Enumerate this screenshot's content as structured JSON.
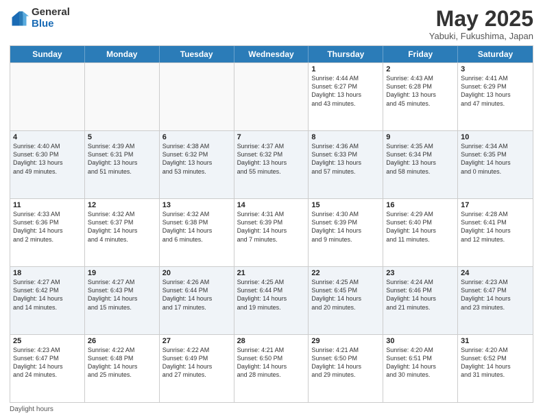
{
  "logo": {
    "general": "General",
    "blue": "Blue"
  },
  "title": "May 2025",
  "location": "Yabuki, Fukushima, Japan",
  "days_of_week": [
    "Sunday",
    "Monday",
    "Tuesday",
    "Wednesday",
    "Thursday",
    "Friday",
    "Saturday"
  ],
  "footer": {
    "daylight_hours": "Daylight hours"
  },
  "rows": [
    [
      {
        "day": "",
        "info": "",
        "empty": true
      },
      {
        "day": "",
        "info": "",
        "empty": true
      },
      {
        "day": "",
        "info": "",
        "empty": true
      },
      {
        "day": "",
        "info": "",
        "empty": true
      },
      {
        "day": "1",
        "info": "Sunrise: 4:44 AM\nSunset: 6:27 PM\nDaylight: 13 hours\nand 43 minutes.",
        "empty": false
      },
      {
        "day": "2",
        "info": "Sunrise: 4:43 AM\nSunset: 6:28 PM\nDaylight: 13 hours\nand 45 minutes.",
        "empty": false
      },
      {
        "day": "3",
        "info": "Sunrise: 4:41 AM\nSunset: 6:29 PM\nDaylight: 13 hours\nand 47 minutes.",
        "empty": false
      }
    ],
    [
      {
        "day": "4",
        "info": "Sunrise: 4:40 AM\nSunset: 6:30 PM\nDaylight: 13 hours\nand 49 minutes.",
        "empty": false
      },
      {
        "day": "5",
        "info": "Sunrise: 4:39 AM\nSunset: 6:31 PM\nDaylight: 13 hours\nand 51 minutes.",
        "empty": false
      },
      {
        "day": "6",
        "info": "Sunrise: 4:38 AM\nSunset: 6:32 PM\nDaylight: 13 hours\nand 53 minutes.",
        "empty": false
      },
      {
        "day": "7",
        "info": "Sunrise: 4:37 AM\nSunset: 6:32 PM\nDaylight: 13 hours\nand 55 minutes.",
        "empty": false
      },
      {
        "day": "8",
        "info": "Sunrise: 4:36 AM\nSunset: 6:33 PM\nDaylight: 13 hours\nand 57 minutes.",
        "empty": false
      },
      {
        "day": "9",
        "info": "Sunrise: 4:35 AM\nSunset: 6:34 PM\nDaylight: 13 hours\nand 58 minutes.",
        "empty": false
      },
      {
        "day": "10",
        "info": "Sunrise: 4:34 AM\nSunset: 6:35 PM\nDaylight: 14 hours\nand 0 minutes.",
        "empty": false
      }
    ],
    [
      {
        "day": "11",
        "info": "Sunrise: 4:33 AM\nSunset: 6:36 PM\nDaylight: 14 hours\nand 2 minutes.",
        "empty": false
      },
      {
        "day": "12",
        "info": "Sunrise: 4:32 AM\nSunset: 6:37 PM\nDaylight: 14 hours\nand 4 minutes.",
        "empty": false
      },
      {
        "day": "13",
        "info": "Sunrise: 4:32 AM\nSunset: 6:38 PM\nDaylight: 14 hours\nand 6 minutes.",
        "empty": false
      },
      {
        "day": "14",
        "info": "Sunrise: 4:31 AM\nSunset: 6:39 PM\nDaylight: 14 hours\nand 7 minutes.",
        "empty": false
      },
      {
        "day": "15",
        "info": "Sunrise: 4:30 AM\nSunset: 6:39 PM\nDaylight: 14 hours\nand 9 minutes.",
        "empty": false
      },
      {
        "day": "16",
        "info": "Sunrise: 4:29 AM\nSunset: 6:40 PM\nDaylight: 14 hours\nand 11 minutes.",
        "empty": false
      },
      {
        "day": "17",
        "info": "Sunrise: 4:28 AM\nSunset: 6:41 PM\nDaylight: 14 hours\nand 12 minutes.",
        "empty": false
      }
    ],
    [
      {
        "day": "18",
        "info": "Sunrise: 4:27 AM\nSunset: 6:42 PM\nDaylight: 14 hours\nand 14 minutes.",
        "empty": false
      },
      {
        "day": "19",
        "info": "Sunrise: 4:27 AM\nSunset: 6:43 PM\nDaylight: 14 hours\nand 15 minutes.",
        "empty": false
      },
      {
        "day": "20",
        "info": "Sunrise: 4:26 AM\nSunset: 6:44 PM\nDaylight: 14 hours\nand 17 minutes.",
        "empty": false
      },
      {
        "day": "21",
        "info": "Sunrise: 4:25 AM\nSunset: 6:44 PM\nDaylight: 14 hours\nand 19 minutes.",
        "empty": false
      },
      {
        "day": "22",
        "info": "Sunrise: 4:25 AM\nSunset: 6:45 PM\nDaylight: 14 hours\nand 20 minutes.",
        "empty": false
      },
      {
        "day": "23",
        "info": "Sunrise: 4:24 AM\nSunset: 6:46 PM\nDaylight: 14 hours\nand 21 minutes.",
        "empty": false
      },
      {
        "day": "24",
        "info": "Sunrise: 4:23 AM\nSunset: 6:47 PM\nDaylight: 14 hours\nand 23 minutes.",
        "empty": false
      }
    ],
    [
      {
        "day": "25",
        "info": "Sunrise: 4:23 AM\nSunset: 6:47 PM\nDaylight: 14 hours\nand 24 minutes.",
        "empty": false
      },
      {
        "day": "26",
        "info": "Sunrise: 4:22 AM\nSunset: 6:48 PM\nDaylight: 14 hours\nand 25 minutes.",
        "empty": false
      },
      {
        "day": "27",
        "info": "Sunrise: 4:22 AM\nSunset: 6:49 PM\nDaylight: 14 hours\nand 27 minutes.",
        "empty": false
      },
      {
        "day": "28",
        "info": "Sunrise: 4:21 AM\nSunset: 6:50 PM\nDaylight: 14 hours\nand 28 minutes.",
        "empty": false
      },
      {
        "day": "29",
        "info": "Sunrise: 4:21 AM\nSunset: 6:50 PM\nDaylight: 14 hours\nand 29 minutes.",
        "empty": false
      },
      {
        "day": "30",
        "info": "Sunrise: 4:20 AM\nSunset: 6:51 PM\nDaylight: 14 hours\nand 30 minutes.",
        "empty": false
      },
      {
        "day": "31",
        "info": "Sunrise: 4:20 AM\nSunset: 6:52 PM\nDaylight: 14 hours\nand 31 minutes.",
        "empty": false
      }
    ]
  ]
}
